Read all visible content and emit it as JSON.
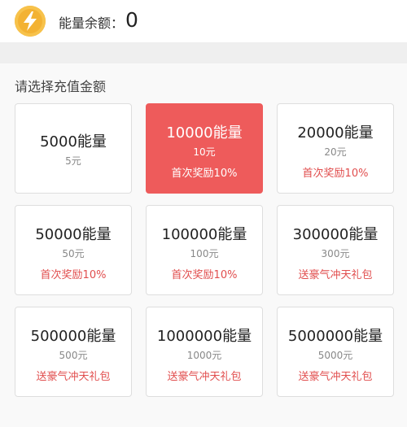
{
  "header": {
    "icon": "lightning-bolt-icon",
    "balance_label": "能量余额：",
    "balance_value": "0"
  },
  "section": {
    "title": "请选择充值金额"
  },
  "accent_color": "#ee5b5b",
  "packages": [
    {
      "amount": "5000能量",
      "price": "5元",
      "bonus": ""
    },
    {
      "amount": "10000能量",
      "price": "10元",
      "bonus": "首次奖励10%",
      "selected": true
    },
    {
      "amount": "20000能量",
      "price": "20元",
      "bonus": "首次奖励10%"
    },
    {
      "amount": "50000能量",
      "price": "50元",
      "bonus": "首次奖励10%"
    },
    {
      "amount": "100000能量",
      "price": "100元",
      "bonus": "首次奖励10%"
    },
    {
      "amount": "300000能量",
      "price": "300元",
      "bonus": "送豪气冲天礼包"
    },
    {
      "amount": "500000能量",
      "price": "500元",
      "bonus": "送豪气冲天礼包"
    },
    {
      "amount": "1000000能量",
      "price": "1000元",
      "bonus": "送豪气冲天礼包"
    },
    {
      "amount": "5000000能量",
      "price": "5000元",
      "bonus": "送豪气冲天礼包"
    }
  ]
}
